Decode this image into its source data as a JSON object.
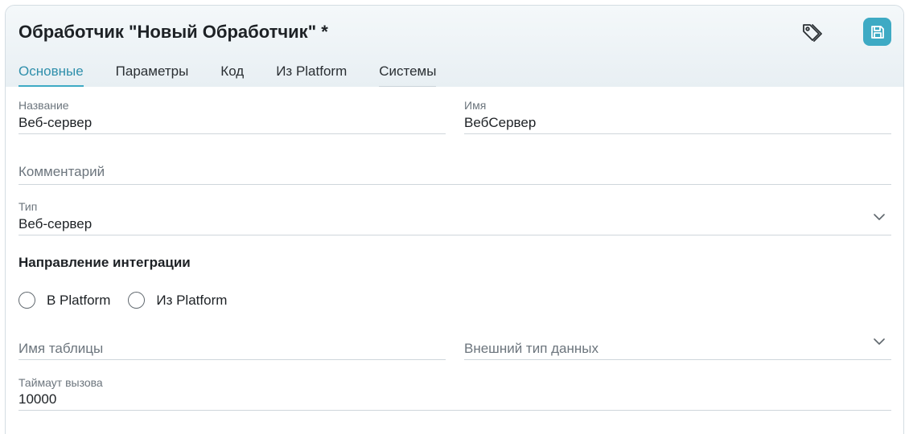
{
  "header": {
    "title": "Обработчик \"Новый Обработчик\" *",
    "tag_icon": "tags-icon",
    "save_icon": "save-icon",
    "accent_color": "#3eaac4"
  },
  "tabs": [
    {
      "label": "Основные",
      "active": true
    },
    {
      "label": "Параметры",
      "active": false
    },
    {
      "label": "Код",
      "active": false
    },
    {
      "label": "Из Platform",
      "active": false
    },
    {
      "label": "Системы",
      "active": false
    }
  ],
  "form": {
    "name": {
      "label": "Название",
      "value": "Веб-сервер"
    },
    "system_name": {
      "label": "Имя",
      "value": "ВебСервер"
    },
    "comment": {
      "placeholder": "Комментарий"
    },
    "type": {
      "label": "Тип",
      "value": "Веб-сервер"
    },
    "direction": {
      "title": "Направление интеграции",
      "options": [
        {
          "label": "В Platform",
          "selected": false
        },
        {
          "label": "Из Platform",
          "selected": false
        }
      ]
    },
    "table_name": {
      "placeholder": "Имя таблицы"
    },
    "external_type": {
      "placeholder": "Внешний тип данных"
    },
    "timeout": {
      "label": "Таймаут вызова",
      "value": "10000"
    }
  }
}
